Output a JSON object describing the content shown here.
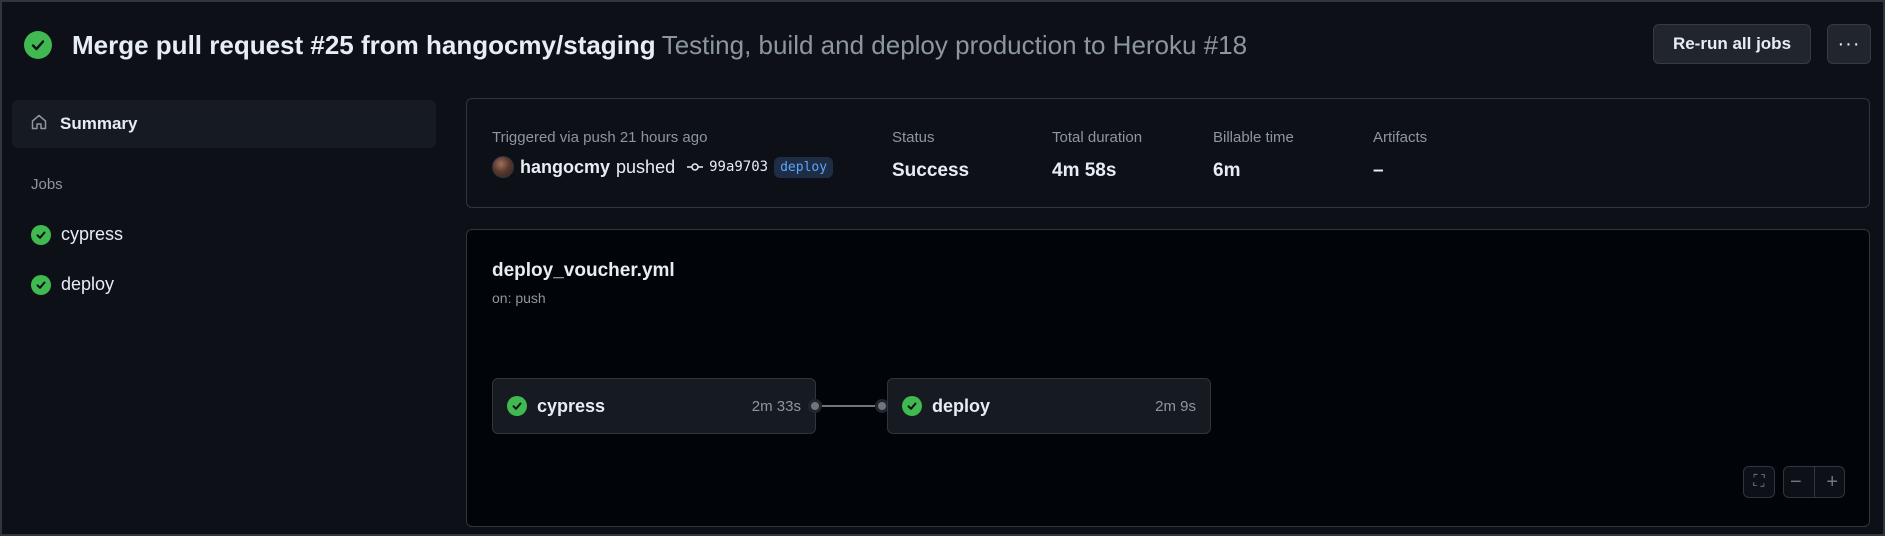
{
  "header": {
    "title": "Merge pull request #25 from hangocmy/staging",
    "subtitle": "Testing, build and deploy production to Heroku #18",
    "rerun_label": "Re-run all jobs",
    "more_label": "···"
  },
  "sidebar": {
    "summary_label": "Summary",
    "jobs_heading": "Jobs",
    "jobs": [
      {
        "label": "cypress",
        "status": "success"
      },
      {
        "label": "deploy",
        "status": "success"
      }
    ]
  },
  "run_info": {
    "trigger_label": "Triggered via push 21 hours ago",
    "actor": "hangocmy",
    "action": "pushed",
    "commit_sha": "99a9703",
    "branch": "deploy",
    "status_label": "Status",
    "status_value": "Success",
    "duration_label": "Total duration",
    "duration_value": "4m 58s",
    "billable_label": "Billable time",
    "billable_value": "6m",
    "artifacts_label": "Artifacts",
    "artifacts_value": "–"
  },
  "workflow": {
    "file": "deploy_voucher.yml",
    "trigger": "on: push",
    "jobs": [
      {
        "name": "cypress",
        "duration": "2m 33s",
        "status": "success"
      },
      {
        "name": "deploy",
        "duration": "2m 9s",
        "status": "success"
      }
    ],
    "controls": {
      "fullscreen": "⛶",
      "zoom_out": "−",
      "zoom_in": "+"
    }
  },
  "colors": {
    "success": "#3fb950",
    "background": "#0d1117",
    "canvas": "#010409",
    "border": "#30363d",
    "muted_text": "#8d96a0",
    "link_blue": "#58a6ff"
  }
}
